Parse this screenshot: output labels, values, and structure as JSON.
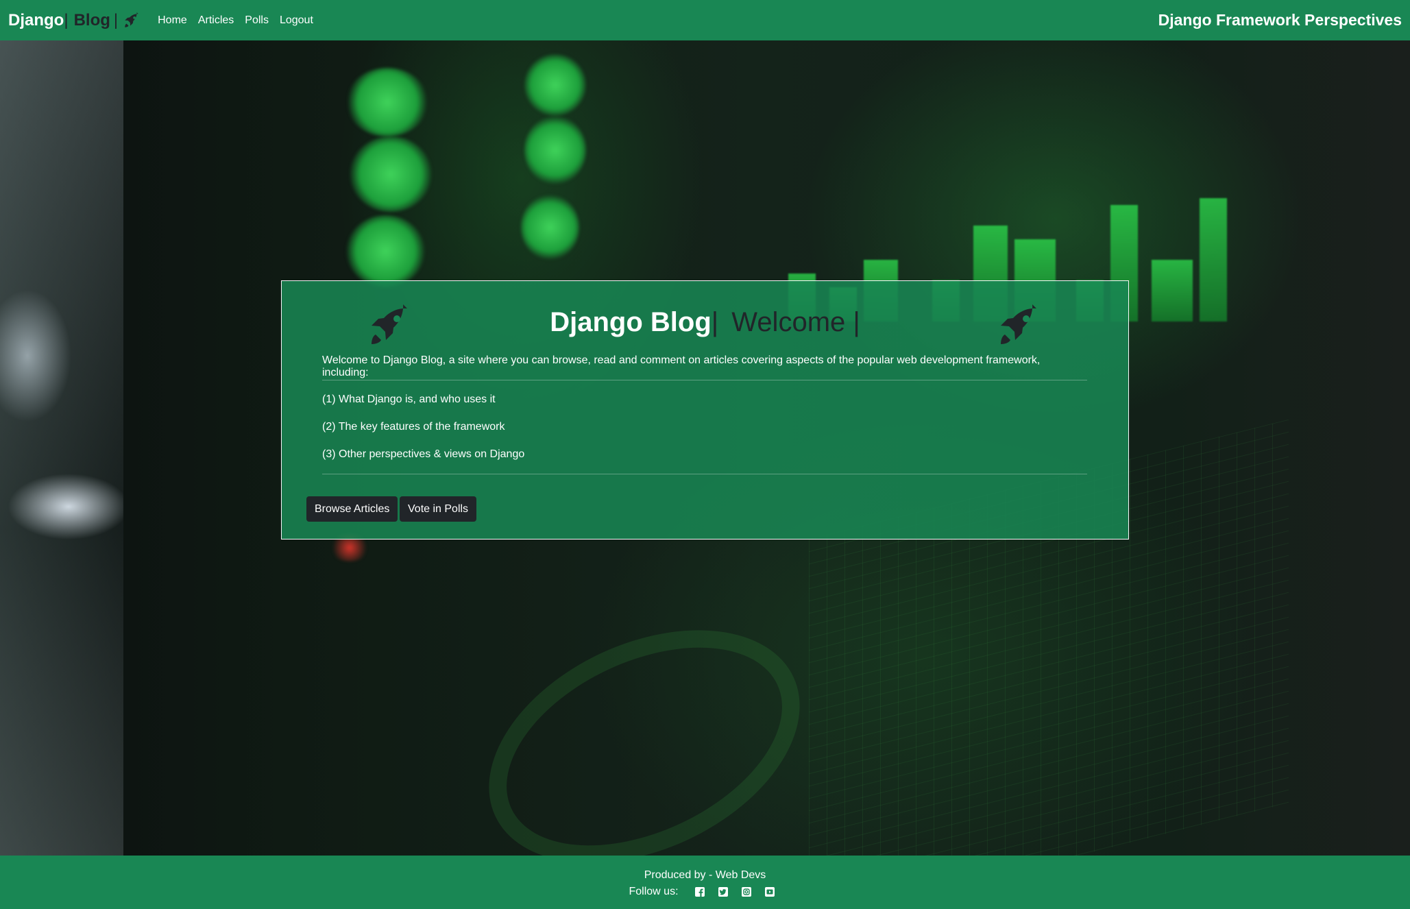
{
  "navbar": {
    "brand_main": "Django",
    "brand_sep": "|",
    "brand_blog": "Blog",
    "brand_sep2": "|",
    "links": [
      "Home",
      "Articles",
      "Polls",
      "Logout"
    ],
    "right_title": "Django Framework Perspectives"
  },
  "card": {
    "title_main": "Django Blog",
    "title_sep": "|",
    "title_welcome": "Welcome |",
    "intro": "Welcome to Django Blog, a site where you can browse, read and comment on articles covering aspects of the popular web development framework, including:",
    "points": [
      "(1) What Django is, and who uses it",
      "(2) The key features of the framework",
      "(3) Other perspectives & views on Django"
    ],
    "buttons": {
      "browse": "Browse Articles",
      "vote": "Vote in Polls"
    },
    "icons": [
      "rocket-icon",
      "rocket-icon"
    ]
  },
  "footer": {
    "produced": "Produced by - Web Devs",
    "follow": "Follow us:",
    "social_icons": [
      "facebook-icon",
      "twitter-icon",
      "instagram-icon",
      "youtube-icon"
    ]
  },
  "colors": {
    "brand_green": "#198754",
    "dark": "#212529",
    "text_light": "#ffffff"
  }
}
